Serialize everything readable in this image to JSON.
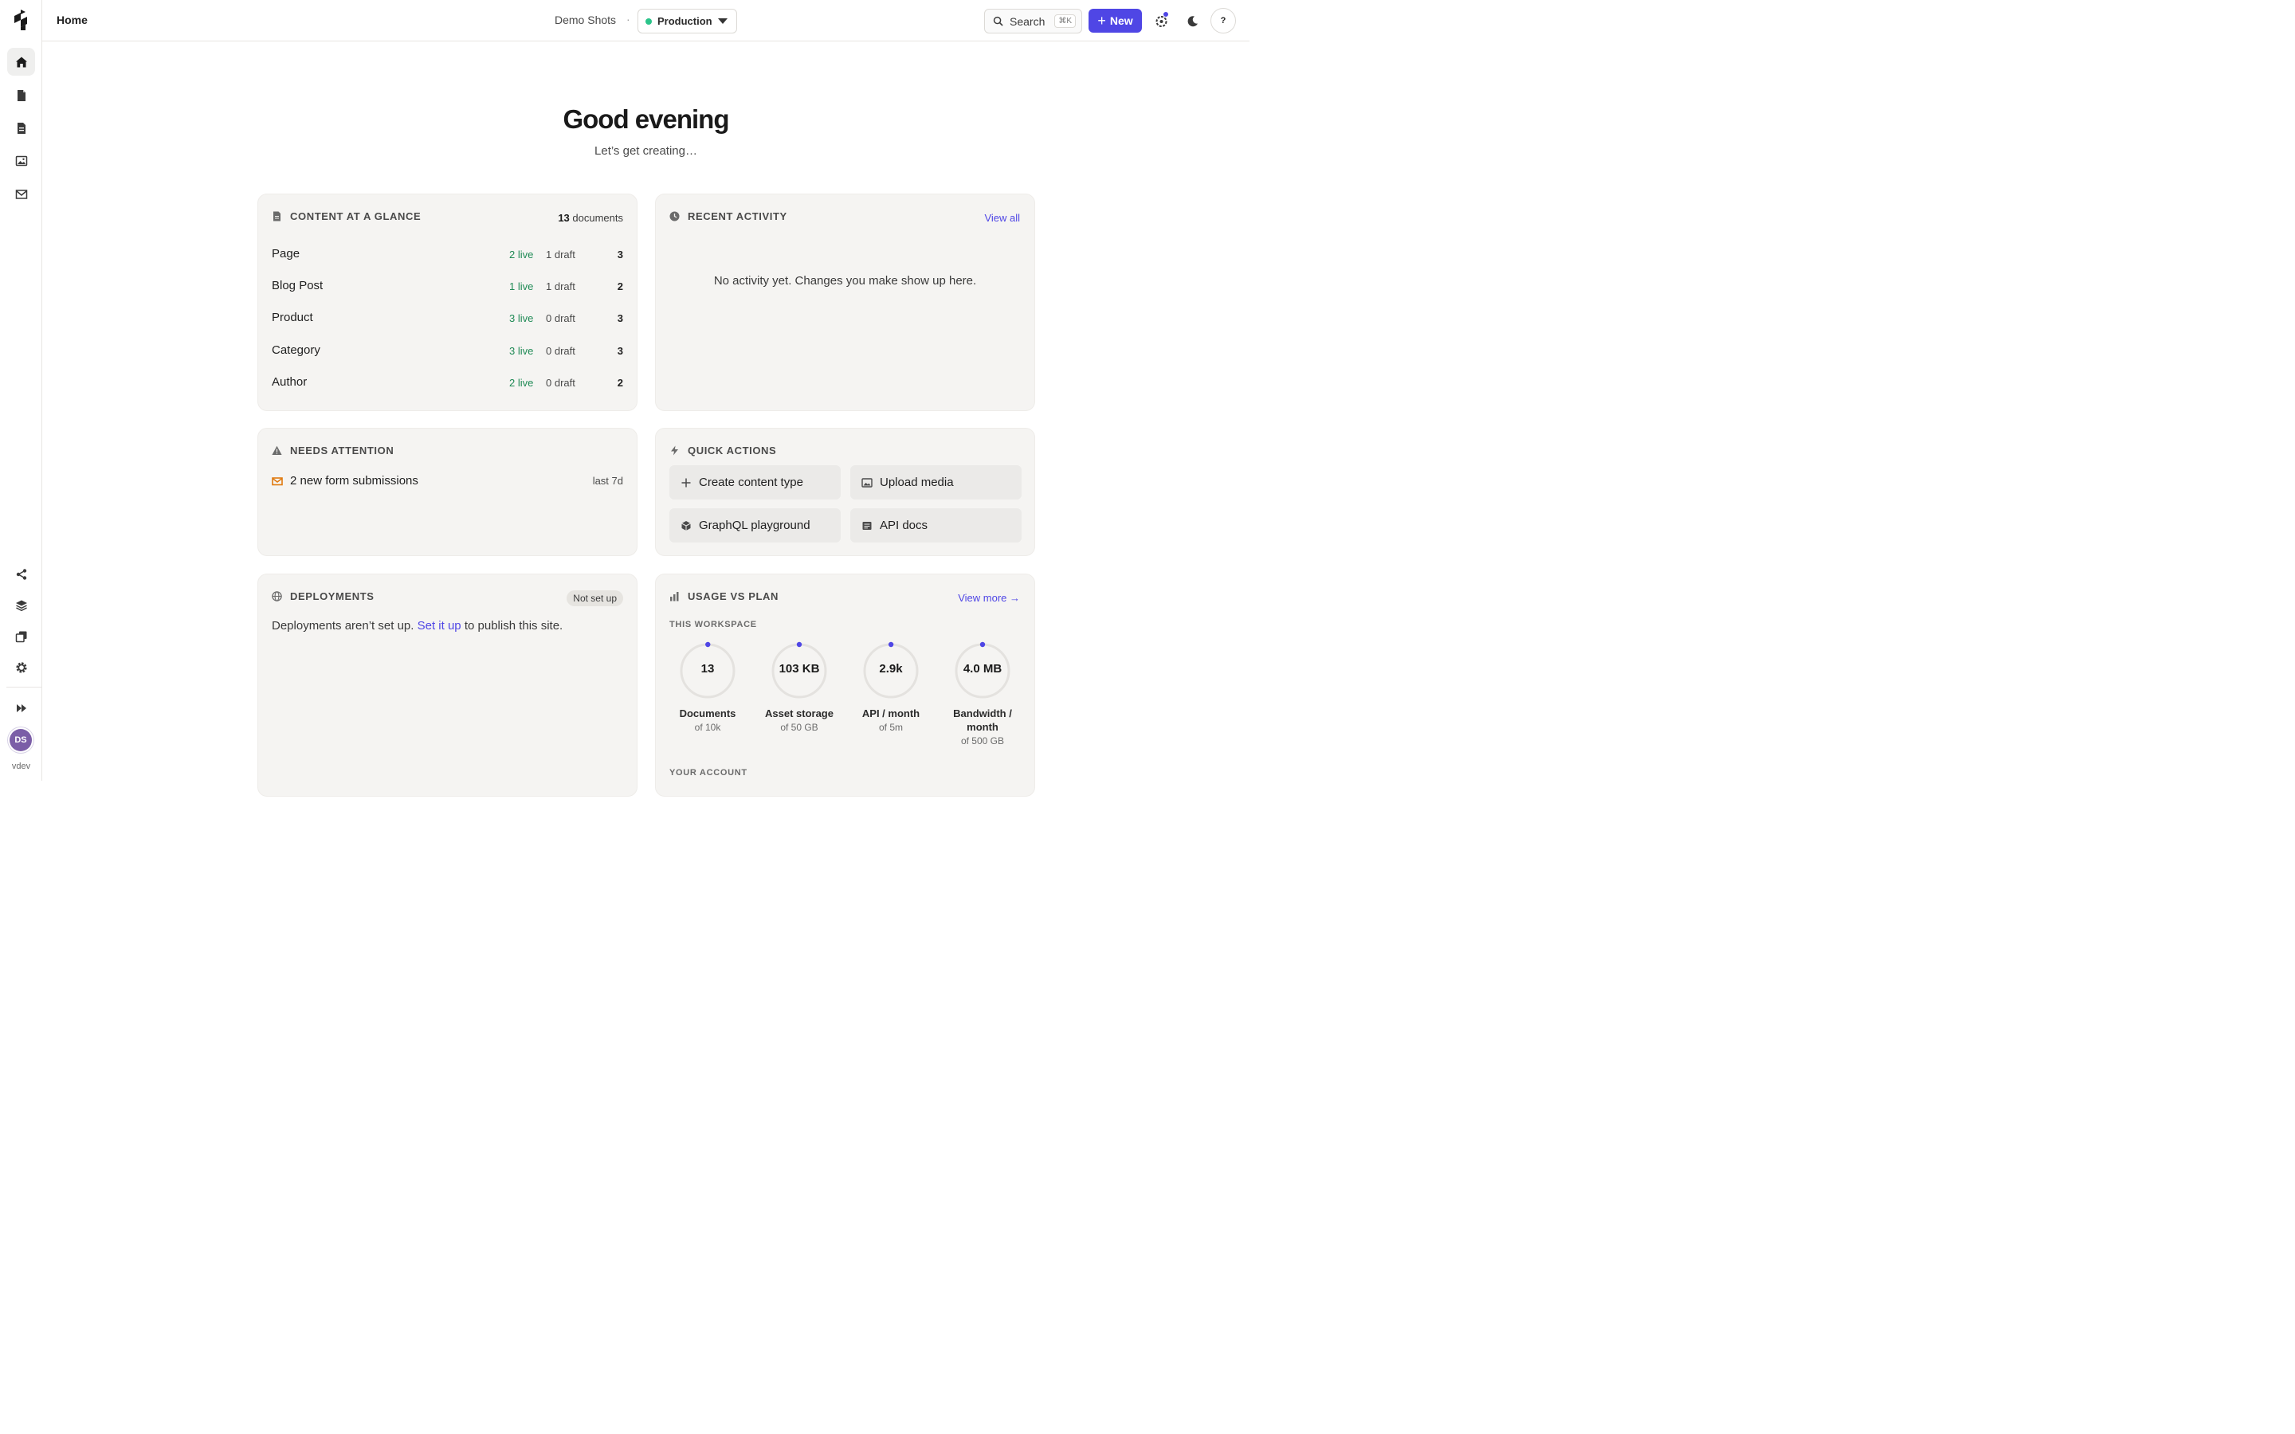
{
  "topbar": {
    "breadcrumb": "Home",
    "project_name": "Demo Shots",
    "separator": "·",
    "environment": "Production",
    "search_label": "Search",
    "search_shortcut": "⌘K",
    "new_label": "New",
    "help_label": "?"
  },
  "sidebar": {
    "user_initials": "DS",
    "environment_label": "vdev"
  },
  "hero": {
    "greeting": "Good evening",
    "subtitle": "Let’s get creating…"
  },
  "content_glance": {
    "title": "CONTENT AT A GLANCE",
    "total_count": "13",
    "total_suffix": "documents",
    "rows": [
      {
        "name": "Page",
        "live": "2 live",
        "draft": "1 draft",
        "total": "3"
      },
      {
        "name": "Blog Post",
        "live": "1 live",
        "draft": "1 draft",
        "total": "2"
      },
      {
        "name": "Product",
        "live": "3 live",
        "draft": "0 draft",
        "total": "3"
      },
      {
        "name": "Category",
        "live": "3 live",
        "draft": "0 draft",
        "total": "3"
      },
      {
        "name": "Author",
        "live": "2 live",
        "draft": "0 draft",
        "total": "2"
      }
    ]
  },
  "recent_activity": {
    "title": "RECENT ACTIVITY",
    "link": "View all",
    "empty_message": "No activity yet. Changes you make show up here."
  },
  "needs_attention": {
    "title": "NEEDS ATTENTION",
    "item_text": "2 new form submissions",
    "item_when": "last 7d"
  },
  "quick_actions": {
    "title": "QUICK ACTIONS",
    "actions": [
      {
        "label": "Create content type",
        "icon": "plus-icon"
      },
      {
        "label": "Upload media",
        "icon": "image-icon"
      },
      {
        "label": "GraphQL playground",
        "icon": "cube-icon"
      },
      {
        "label": "API docs",
        "icon": "doc-icon"
      }
    ]
  },
  "deployments": {
    "title": "DEPLOYMENTS",
    "badge": "Not set up",
    "text_before": "Deployments aren’t set up.",
    "link": "Set it up",
    "text_after": "to publish this site."
  },
  "usage": {
    "title": "USAGE VS PLAN",
    "link": "View more →",
    "workspace_label": "THIS WORKSPACE",
    "account_label": "YOUR ACCOUNT",
    "accent_color": "#4f46e5",
    "gauges": [
      {
        "value": "13",
        "label": "Documents",
        "limit": "of 10k",
        "fraction": 0.0013
      },
      {
        "value": "103 KB",
        "label": "Asset storage",
        "limit": "of 50 GB",
        "fraction": 2e-06
      },
      {
        "value": "2.9k",
        "label": "API / month",
        "limit": "of 5m",
        "fraction": 0.00058
      },
      {
        "value": "4.0 MB",
        "label": "Bandwidth / month",
        "limit": "of 500 GB",
        "fraction": 8e-06
      }
    ]
  }
}
